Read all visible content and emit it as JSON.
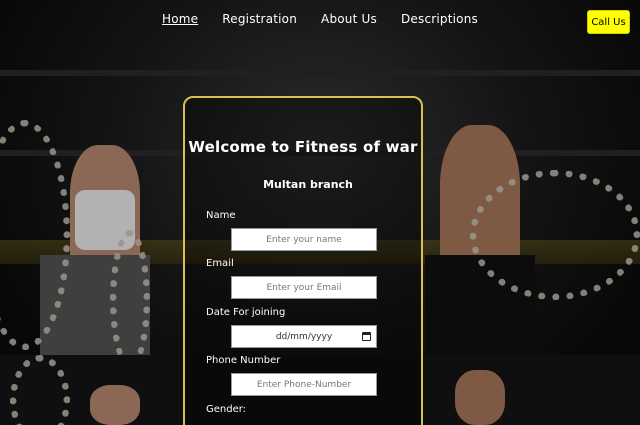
{
  "nav": {
    "items": [
      {
        "label": "Home",
        "active": true
      },
      {
        "label": "Registration",
        "active": false
      },
      {
        "label": "About Us",
        "active": false
      },
      {
        "label": "Descriptions",
        "active": false
      }
    ],
    "call_label": "Call Us"
  },
  "form": {
    "title": "Welcome to Fitness of war",
    "branch": "Multan branch",
    "name_label": "Name",
    "name_placeholder": "Enter your name",
    "email_label": "Email",
    "email_placeholder": "Enter your Email",
    "date_label": "Date For joining",
    "date_placeholder": "dd/mm/yyyy",
    "phone_label": "Phone Number",
    "phone_placeholder": "Enter Phone-Number",
    "gender_label": "Gender:"
  },
  "colors": {
    "call_button": "#ffff00",
    "card_border": "#d8c051"
  },
  "icons": {
    "date_picker": "calendar-icon"
  }
}
